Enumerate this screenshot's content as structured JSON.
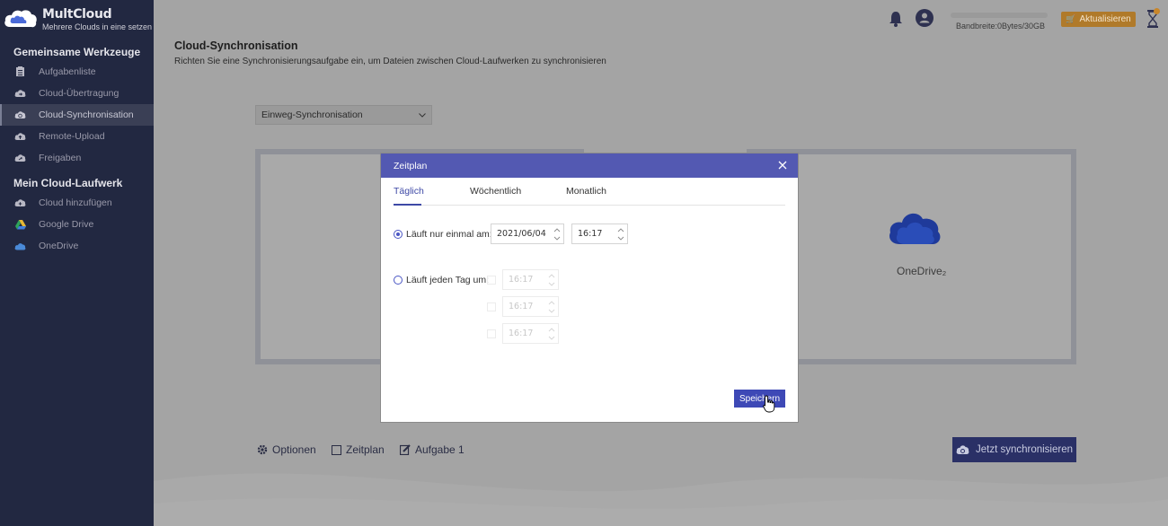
{
  "brand": {
    "name": "MultCloud",
    "tagline": "Mehrere Clouds in eine setzen"
  },
  "sidebar": {
    "section1": "Gemeinsame Werkzeuge",
    "items1": [
      {
        "label": "Aufgabenliste",
        "icon": "task-list-icon"
      },
      {
        "label": "Cloud-Übertragung",
        "icon": "cloud-transfer-icon"
      },
      {
        "label": "Cloud-Synchronisation",
        "icon": "cloud-sync-icon",
        "active": true
      },
      {
        "label": "Remote-Upload",
        "icon": "remote-upload-icon"
      },
      {
        "label": "Freigaben",
        "icon": "share-icon"
      }
    ],
    "section2": "Mein Cloud-Laufwerk",
    "items2": [
      {
        "label": "Cloud hinzufügen",
        "icon": "add-cloud-icon"
      },
      {
        "label": "Google Drive",
        "icon": "google-drive-icon"
      },
      {
        "label": "OneDrive",
        "icon": "onedrive-icon"
      }
    ]
  },
  "topbar": {
    "bandwidth": "Bandbreite:0Bytes/30GB",
    "bandwidth_used_fraction": 0,
    "upgrade": "Aktualisieren"
  },
  "page": {
    "title": "Cloud-Synchronisation",
    "subtitle": "Richten Sie eine Synchronisierungsaufgabe ein, um Dateien zwischen Cloud-Laufwerken zu synchronisieren",
    "sync_mode": "Einweg-Synchronisation",
    "target_label": "OneDrive₂"
  },
  "bottom": {
    "options": "Optionen",
    "schedule": "Zeitplan",
    "task": "Aufgabe 1",
    "sync_now": "Jetzt synchronisieren"
  },
  "dialog": {
    "title": "Zeitplan",
    "tabs": [
      "Täglich",
      "Wöchentlich",
      "Monatlich"
    ],
    "active_tab": "Täglich",
    "option_once": "Läuft nur einmal am:",
    "option_daily": "Läuft jeden Tag um:",
    "once_date": "2021/06/04",
    "once_time": "16:17",
    "daily_times": [
      "16:17",
      "16:17",
      "16:17"
    ],
    "save": "Speichern"
  },
  "colors": {
    "sidebar": "#222841",
    "accent": "#5359b2",
    "button": "#3e49b6",
    "upgrade": "#b07a2a"
  }
}
